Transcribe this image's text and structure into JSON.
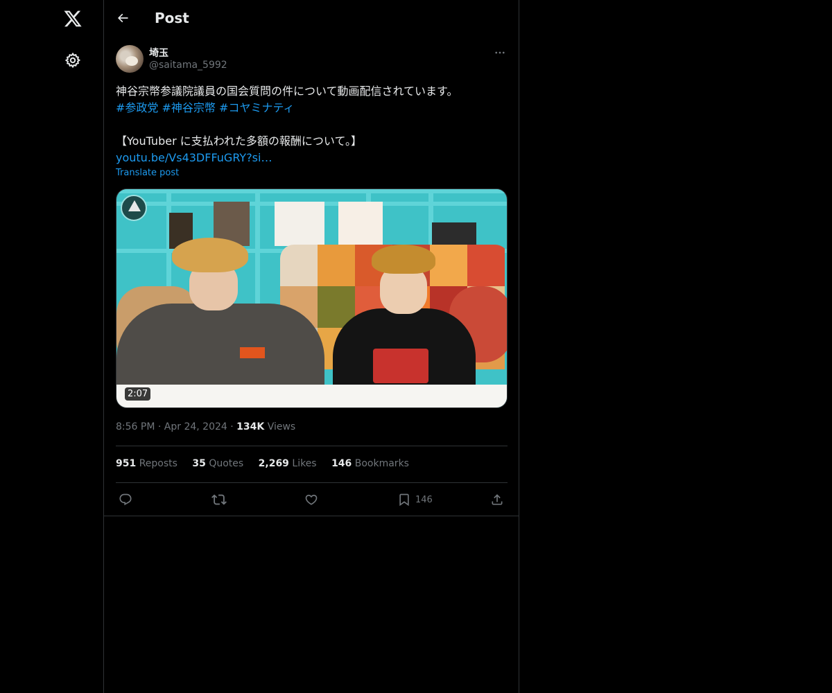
{
  "header": {
    "title": "Post"
  },
  "author": {
    "name": "埼玉",
    "handle": "@saitama_5992"
  },
  "post": {
    "line1": "神谷宗幣参議院議員の国会質問の件について動画配信されています。",
    "hashtags": [
      "#参政党",
      "#神谷宗幣",
      "#コヤミナティ"
    ],
    "line3": "【YouTuber に支払われた多額の報酬について。】",
    "link": "youtu.be/Vs43DFFuGRY?si…",
    "translate": "Translate post"
  },
  "media": {
    "duration": "2:07"
  },
  "meta": {
    "time": "8:56 PM",
    "date": "Apr 24, 2024",
    "views_count": "134K",
    "views_label": "Views",
    "sep": "·"
  },
  "stats": [
    {
      "count": "951",
      "label": "Reposts"
    },
    {
      "count": "35",
      "label": "Quotes"
    },
    {
      "count": "2,269",
      "label": "Likes"
    },
    {
      "count": "146",
      "label": "Bookmarks"
    }
  ],
  "actions": {
    "bookmark_count": "146"
  },
  "icons": {
    "logo": "x-logo-icon",
    "settings": "gear-icon",
    "back": "arrow-left-icon",
    "more": "more-dots-icon",
    "reply": "reply-icon",
    "repost": "repost-icon",
    "like": "heart-icon",
    "bookmark": "bookmark-icon",
    "share": "share-icon"
  },
  "colors": {
    "background": "#000000",
    "text": "#e7e9ea",
    "muted": "#71767b",
    "accent": "#1d9bf0",
    "border": "#2f3336"
  }
}
